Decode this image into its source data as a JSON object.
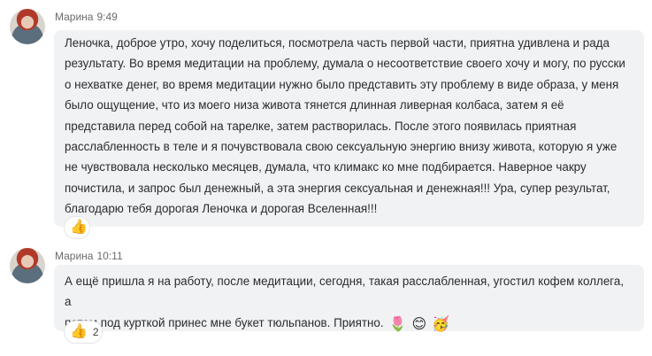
{
  "messages": [
    {
      "author": "Марина",
      "time": "9:49",
      "text": "Леночка, доброе утро, хочу поделиться, посмотрела часть первой части, приятна удивлена и рада\nрезультату. Во время медитации на проблему, думала о несоответствие своего хочу и могу, по русски\nо нехватке денег, во время медитации нужно было представить эту проблему в виде образа, у меня\nбыло ощущение, что из моего низа живота тянется длинная ливерная колбаса, затем я её\nпредставила перед собой на тарелке, затем растворилась.  После этого появилась приятная\nрасслабленность в теле и я почувствовала свою сексуальную энергию внизу живота, которую я уже\nне чувствовала несколько месяцев, думала, что климакс ко мне подбирается. Наверное чакру\nпочистила, и запрос был денежный, а эта энергия сексуальная и денежная!!! Ура, супер результат,\nблагодарю тебя дорогая Леночка и дорогая Вселенная!!!",
      "reaction": {
        "icon": "thumbs-up-icon",
        "glyph": "👍",
        "count": ""
      }
    },
    {
      "author": "Марина",
      "time": "10:11",
      "text": "А ещё пришла я на работу, после медитации, сегодня, такая расслабленная, угостил кофем коллега, а\nпотом под курткой принес мне букет тюльпанов. Приятно.",
      "emojis": [
        {
          "icon": "flower-icon",
          "glyph": "🌷"
        },
        {
          "icon": "smile-icon",
          "glyph": "😊"
        },
        {
          "icon": "party-face-icon",
          "glyph": "🥳"
        }
      ],
      "reaction": {
        "icon": "thumbs-up-icon",
        "glyph": "👍",
        "count": "2"
      }
    }
  ]
}
